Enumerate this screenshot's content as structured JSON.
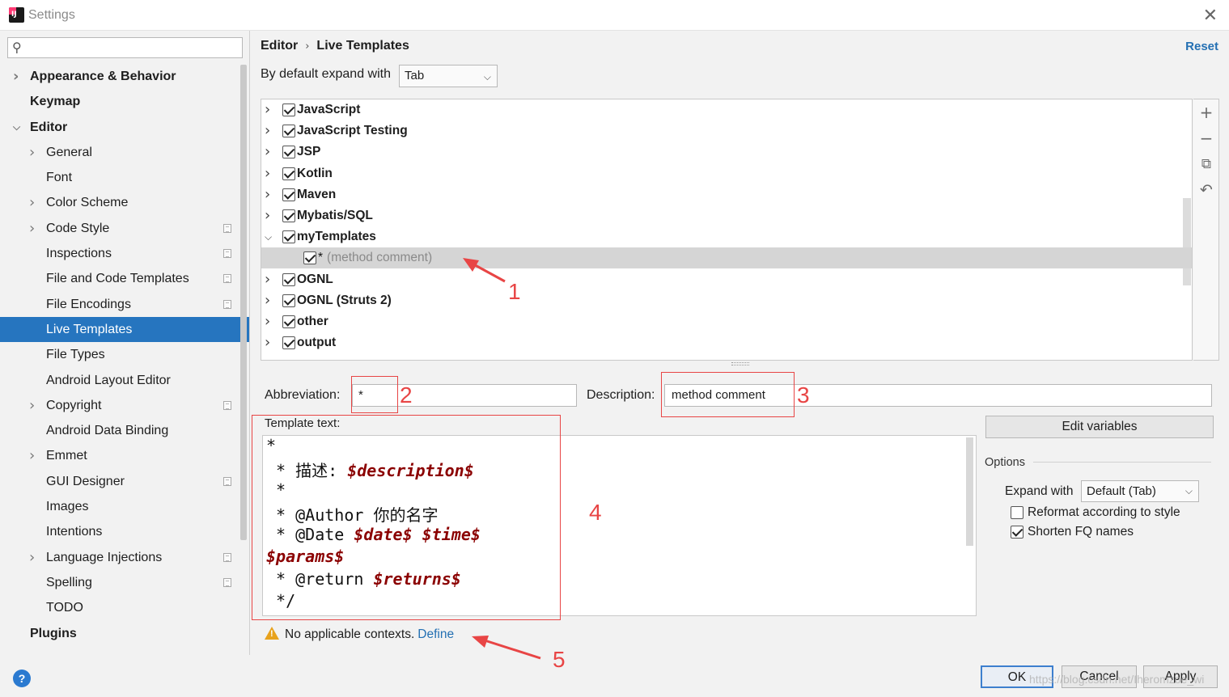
{
  "window": {
    "title": "Settings"
  },
  "search": {
    "placeholder": "",
    "value": ""
  },
  "sidebar": {
    "items": [
      {
        "label": "Appearance & Behavior",
        "level": 0,
        "bold": true,
        "chevron": "right"
      },
      {
        "label": "Keymap",
        "level": 0,
        "bold": true,
        "chevron": ""
      },
      {
        "label": "Editor",
        "level": 0,
        "bold": true,
        "chevron": "down"
      },
      {
        "label": "General",
        "level": 1,
        "chevron": "right"
      },
      {
        "label": "Font",
        "level": 1,
        "chevron": ""
      },
      {
        "label": "Color Scheme",
        "level": 1,
        "chevron": "right"
      },
      {
        "label": "Code Style",
        "level": 1,
        "chevron": "right",
        "icon": "project-settings-icon"
      },
      {
        "label": "Inspections",
        "level": 1,
        "chevron": "",
        "icon": "project-settings-icon"
      },
      {
        "label": "File and Code Templates",
        "level": 1,
        "chevron": "",
        "icon": "project-settings-icon"
      },
      {
        "label": "File Encodings",
        "level": 1,
        "chevron": "",
        "icon": "project-settings-icon"
      },
      {
        "label": "Live Templates",
        "level": 1,
        "chevron": "",
        "selected": true
      },
      {
        "label": "File Types",
        "level": 1,
        "chevron": ""
      },
      {
        "label": "Android Layout Editor",
        "level": 1,
        "chevron": ""
      },
      {
        "label": "Copyright",
        "level": 1,
        "chevron": "right",
        "icon": "project-settings-icon"
      },
      {
        "label": "Android Data Binding",
        "level": 1,
        "chevron": ""
      },
      {
        "label": "Emmet",
        "level": 1,
        "chevron": "right"
      },
      {
        "label": "GUI Designer",
        "level": 1,
        "chevron": "",
        "icon": "project-settings-icon"
      },
      {
        "label": "Images",
        "level": 1,
        "chevron": ""
      },
      {
        "label": "Intentions",
        "level": 1,
        "chevron": ""
      },
      {
        "label": "Language Injections",
        "level": 1,
        "chevron": "right",
        "icon": "project-settings-icon"
      },
      {
        "label": "Spelling",
        "level": 1,
        "chevron": "",
        "icon": "project-settings-icon"
      },
      {
        "label": "TODO",
        "level": 1,
        "chevron": ""
      },
      {
        "label": "Plugins",
        "level": 0,
        "bold": true,
        "chevron": ""
      }
    ]
  },
  "header": {
    "breadcrumb_parent": "Editor",
    "breadcrumb_separator": "›",
    "breadcrumb_current": "Live Templates",
    "reset_label": "Reset"
  },
  "expand_default": {
    "label": "By default expand with",
    "value": "Tab"
  },
  "template_groups": [
    {
      "name": "JavaScript",
      "checked": true,
      "expanded": false
    },
    {
      "name": "JavaScript Testing",
      "checked": true,
      "expanded": false
    },
    {
      "name": "JSP",
      "checked": true,
      "expanded": false
    },
    {
      "name": "Kotlin",
      "checked": true,
      "expanded": false
    },
    {
      "name": "Maven",
      "checked": true,
      "expanded": false
    },
    {
      "name": "Mybatis/SQL",
      "checked": true,
      "expanded": false
    },
    {
      "name": "myTemplates",
      "checked": true,
      "expanded": true
    },
    {
      "name": "OGNL",
      "checked": true,
      "expanded": false
    },
    {
      "name": "OGNL (Struts 2)",
      "checked": true,
      "expanded": false
    },
    {
      "name": "other",
      "checked": true,
      "expanded": false
    },
    {
      "name": "output",
      "checked": true,
      "expanded": false
    }
  ],
  "selected_template": {
    "abbreviation": "*",
    "description": "(method comment)",
    "checked": true
  },
  "tree_tools": {
    "add": "+",
    "remove": "−",
    "copy": "⧉",
    "restore": "↶"
  },
  "form": {
    "abbreviation_label": "Abbreviation:",
    "abbreviation_value": "*",
    "description_label": "Description:",
    "description_value": "method comment",
    "template_text_label": "Template text:",
    "edit_variables_label": "Edit variables"
  },
  "template_text": [
    [
      {
        "t": "*"
      }
    ],
    [
      {
        "t": " * 描述: "
      },
      {
        "t": "$description$",
        "var": true
      }
    ],
    [
      {
        "t": " *"
      }
    ],
    [
      {
        "t": " * @Author 你的名字"
      }
    ],
    [
      {
        "t": " * @Date "
      },
      {
        "t": "$date$",
        "var": true
      },
      {
        "t": " "
      },
      {
        "t": "$time$",
        "var": true
      }
    ],
    [
      {
        "t": "$params$",
        "var": true
      }
    ],
    [
      {
        "t": " * @return "
      },
      {
        "t": "$returns$",
        "var": true
      }
    ],
    [
      {
        "t": " */"
      }
    ]
  ],
  "options": {
    "title": "Options",
    "expand_with_label": "Expand with",
    "expand_with_value": "Default (Tab)",
    "reformat_label": "Reformat according to style",
    "reformat_checked": false,
    "shorten_label": "Shorten FQ names",
    "shorten_checked": true
  },
  "warning": {
    "text": "No applicable contexts.",
    "link": "Define"
  },
  "buttons": {
    "ok": "OK",
    "cancel": "Cancel",
    "apply": "Apply"
  },
  "annotations": {
    "n1": "1",
    "n2": "2",
    "n3": "3",
    "n4": "4",
    "n5": "5",
    "color": "#e84545"
  },
  "watermark": "https://blog.csdn.net/Iheromzoe_wi",
  "colors": {
    "selection": "#2675bf",
    "link": "#2470b3",
    "variable": "#8b0000"
  }
}
